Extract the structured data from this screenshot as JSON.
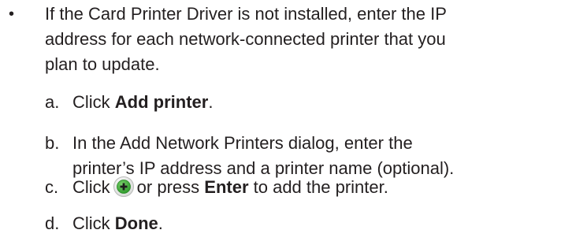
{
  "bullet": {
    "marker": "•",
    "lines": [
      "If the Card Printer Driver is not installed, enter the IP",
      "address for each network-connected printer that you",
      "plan to update."
    ]
  },
  "steps": [
    {
      "letter": "a.",
      "pre": "Click ",
      "bold": "Add printer",
      "post": "."
    },
    {
      "letter": "b.",
      "lines": [
        "In the Add Network Printers dialog, enter the",
        "printer’s IP address and a printer name (optional)."
      ]
    },
    {
      "letter": "c.",
      "pre": "Click",
      "icon": "add-circle-icon",
      "mid": "or press ",
      "bold": "Enter",
      "post": " to add the printer."
    },
    {
      "letter": "d.",
      "pre": "Click ",
      "bold": "Done",
      "post": "."
    }
  ],
  "colors": {
    "text": "#231f20",
    "icon_green": "#3aa935"
  }
}
